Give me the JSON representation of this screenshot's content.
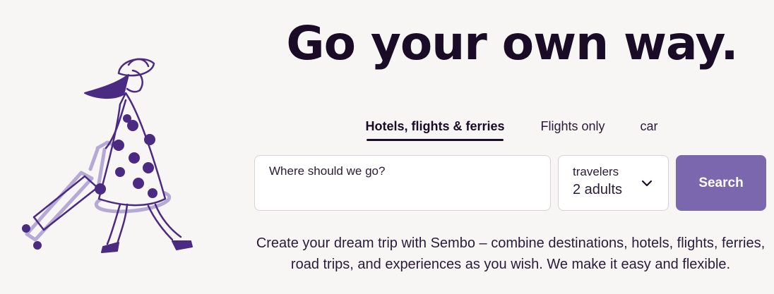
{
  "hero": {
    "title": "Go your own way."
  },
  "tabs": [
    {
      "label": "Hotels, flights & ferries",
      "active": true
    },
    {
      "label": "Flights only",
      "active": false
    },
    {
      "label": "car",
      "active": false
    }
  ],
  "search": {
    "destination_placeholder": "Where should we go?",
    "destination_value": "",
    "travelers_label": "travelers",
    "travelers_value": "2 adults",
    "button_label": "Search"
  },
  "description": "Create your dream trip with Sembo – combine destinations, hotels, flights, ferries, road trips, and experiences as you wish. We make it easy and flexible.",
  "colors": {
    "background": "#f7f6f4",
    "text": "#1a0b26",
    "accent_purple": "#7a67ad",
    "illustration_dark": "#4b2a82",
    "illustration_light": "#b5aad6"
  }
}
